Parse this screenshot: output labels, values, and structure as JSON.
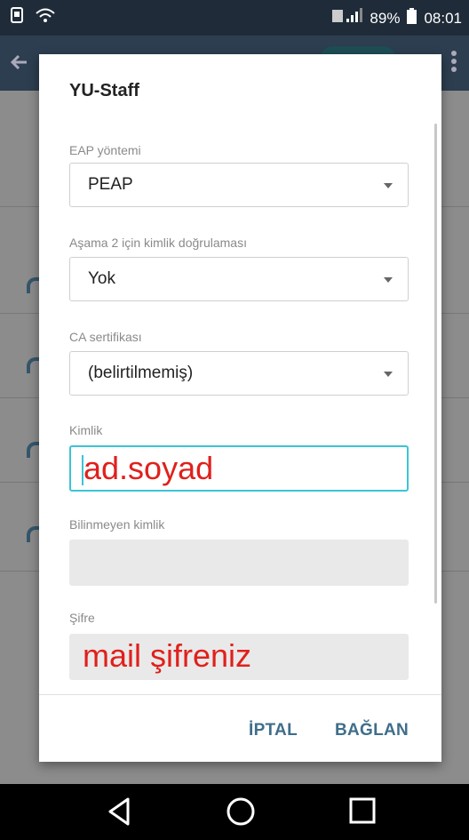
{
  "status_bar": {
    "battery_percent": "89%",
    "time": "08:01"
  },
  "dialog": {
    "title": "YU-Staff",
    "eap_method": {
      "label": "EAP yöntemi",
      "value": "PEAP"
    },
    "phase2_auth": {
      "label": "Aşama 2 için kimlik doğrulaması",
      "value": "Yok"
    },
    "ca_cert": {
      "label": "CA sertifikası",
      "value": "(belirtilmemiş)"
    },
    "identity": {
      "label": "Kimlik",
      "value": "ad.soyad"
    },
    "anonymous_identity": {
      "label": "Bilinmeyen kimlik",
      "value": ""
    },
    "password": {
      "label": "Şifre",
      "value": "mail şifreniz"
    },
    "cancel_label": "İPTAL",
    "connect_label": "BAĞLAN"
  },
  "colors": {
    "accent": "#3bc4d6",
    "button_text": "#3f6e8a",
    "annotation_red": "#e0201c",
    "status_bar": "#1f2b38"
  },
  "icons": [
    "sim-icon",
    "wifi-icon",
    "signal-icon",
    "battery-icon",
    "back-icon",
    "home-icon",
    "recents-icon"
  ]
}
